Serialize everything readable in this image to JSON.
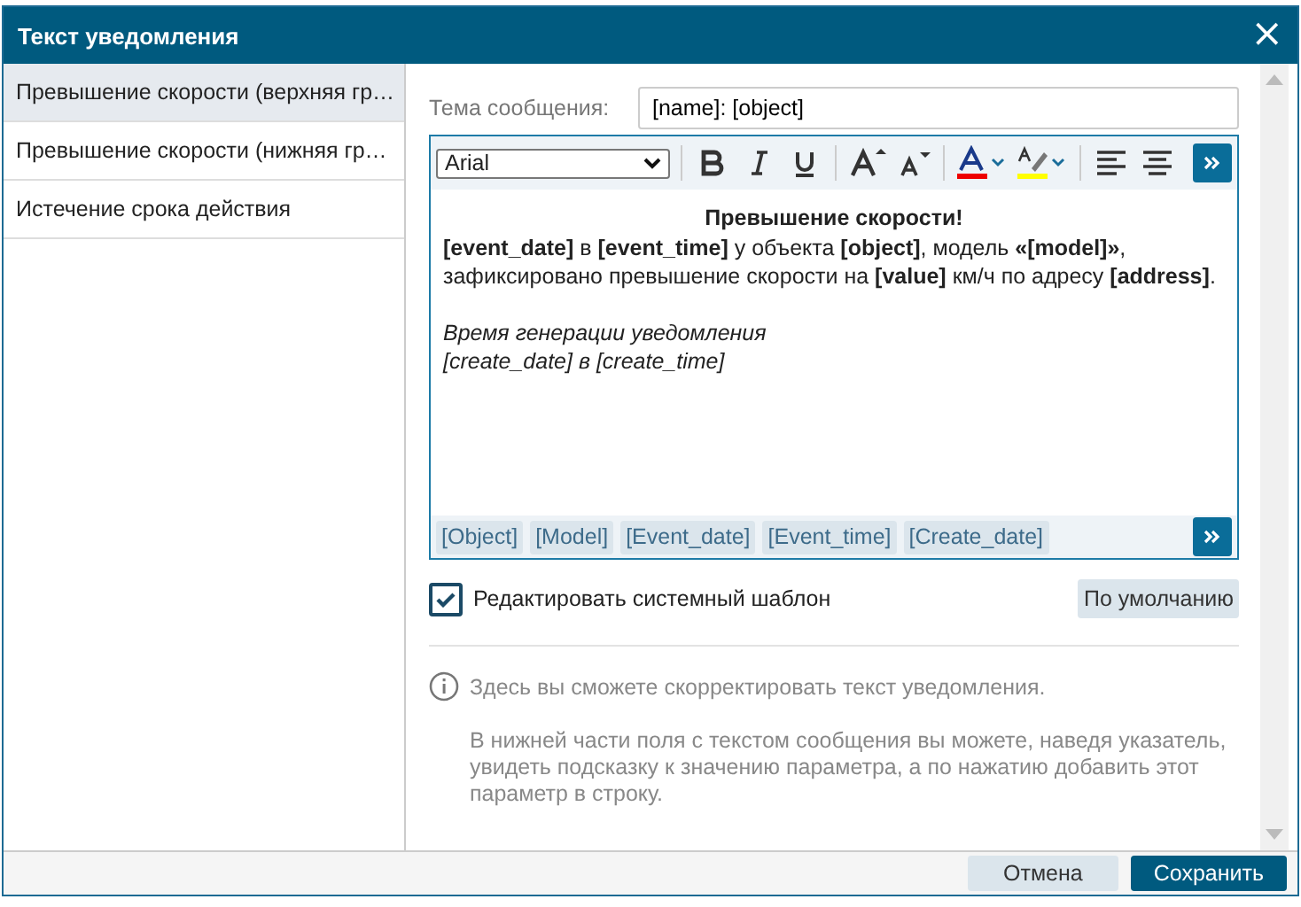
{
  "window": {
    "title": "Текст уведомления",
    "close": "×"
  },
  "sidebar": {
    "items": [
      {
        "label": "Превышение скорости (верхняя гр…",
        "selected": true
      },
      {
        "label": "Превышение скорости (нижняя гр…",
        "selected": false
      },
      {
        "label": "Истечение срока действия",
        "selected": false
      }
    ]
  },
  "subject": {
    "label": "Тема сообщения:",
    "value": "[name]: [object]"
  },
  "editor": {
    "font": "Arial",
    "lines": [
      {
        "kind": "heading",
        "text": "Превышение скорости!"
      },
      {
        "kind": "text",
        "text": "**[event_date]** в **[event_time]** у объекта **[object]**, модель **«[model]»**,"
      },
      {
        "kind": "text",
        "text": "зафиксировано превышение скорости на **[value]** км/ч по адресу **[address]**."
      },
      {
        "kind": "blank"
      },
      {
        "kind": "italic",
        "text": "Время генерации уведомления"
      },
      {
        "kind": "italic",
        "text": "[create_date] в [create_time]"
      }
    ],
    "tags": [
      "[Object]",
      "[Model]",
      "[Event_date]",
      "[Event_time]",
      "[Create_date]"
    ]
  },
  "system_template": {
    "label": "Редактировать системный шаблон",
    "checked": true
  },
  "default_button": "По умолчанию",
  "info": [
    "Здесь вы сможете скорректировать текст уведомления.",
    "В нижней части поля с текстом сообщения вы можете, наведя указатель, увидеть подсказку к значению параметра, а по нажатию добавить этот параметр в строку."
  ],
  "buttons": [
    {
      "label": "Отмена",
      "kind": "secondary"
    },
    {
      "label": "Сохранить",
      "kind": "primary"
    }
  ]
}
